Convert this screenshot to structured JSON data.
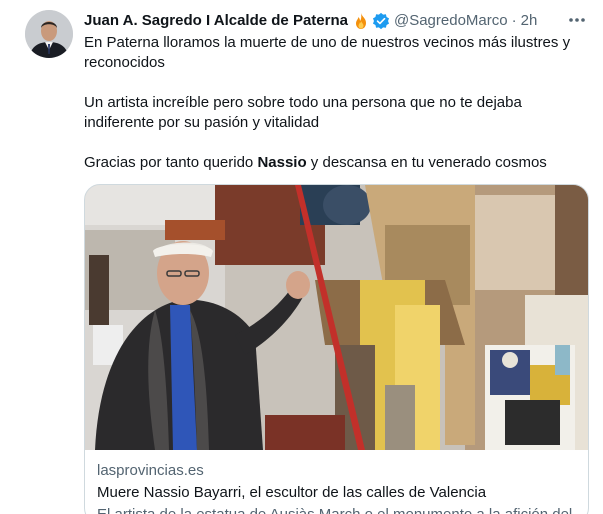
{
  "author": {
    "display_name": "Juan A. Sagredo I Alcalde de Paterna",
    "name_emoji": "fire-icon",
    "verified_badge": "verified-badge-icon",
    "handle": "@SagredoMarco",
    "separator": "·",
    "time": "2h"
  },
  "tweet": {
    "paragraph_1": "En Paterna lloramos la muerte de uno de nuestros vecinos más ilustres y reconocidos",
    "paragraph_2": "Un artista increíble pero sobre todo una persona que no te dejaba indiferente por su pasión y vitalidad",
    "paragraph_3_before": "Gracias por tanto querido ",
    "paragraph_3_bold": "Nassio",
    "paragraph_3_after": " y descansa en tu venerado cosmos"
  },
  "link_card": {
    "domain": "lasprovincias.es",
    "title": "Muere Nassio Bayarri, el escultor de las calles de Valencia",
    "description": "El artista de la estatua de Ausiàs March o el monumento a la afición del"
  },
  "icons": {
    "more": "more-options-icon"
  },
  "colors": {
    "text_primary": "#0f1419",
    "text_secondary": "#536471",
    "verified_blue": "#1d9bf0",
    "card_border": "#cfd9de"
  }
}
